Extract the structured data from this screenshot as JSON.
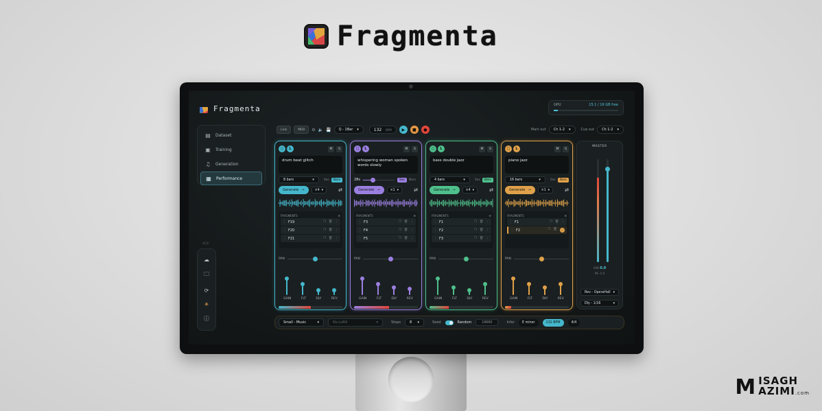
{
  "brand": {
    "name": "Fragmenta"
  },
  "signature": {
    "initial": "M",
    "line1": "ISAGH",
    "line2": "AZIMI",
    "suffix": ".com"
  },
  "app": {
    "name": "Fragmenta",
    "gpu": {
      "label": "GPU",
      "value": "15.1 / 16 GB free",
      "usage": 0.06
    },
    "nav": [
      {
        "label": "Dataset",
        "icon": "database-icon"
      },
      {
        "label": "Training",
        "icon": "training-icon"
      },
      {
        "label": "Generation",
        "icon": "music-note-icon"
      },
      {
        "label": "Performance",
        "icon": "performance-icon"
      }
    ],
    "tools_caption": "v1.0",
    "toolbar": {
      "link_label": "Link",
      "midi_label": "MIDI",
      "quantize": "Q - 1Bar",
      "bpm_value": "132",
      "bpm_unit": "BPM",
      "main_out_label": "Main out",
      "main_out_value": "Ch 1-2",
      "cue_out_label": "Cue out",
      "cue_out_value": "Ch 1-2"
    },
    "tracks": [
      {
        "prompt": "drum beat glitch",
        "length": "8 bars",
        "sec_label": "Sec",
        "bars_label": "Bars",
        "generate_label": "Generate",
        "multiplier": "×4",
        "fragments_title": "FRAGMENTS",
        "fragments": [
          "F19",
          "F20",
          "F21"
        ],
        "pan_label": "PAN",
        "fader_labels": [
          "GAIN",
          "FLT",
          "DLY",
          "REV"
        ],
        "fader_levels": [
          0.75,
          0.45,
          0.15,
          0.15
        ],
        "pan_value": 0.5,
        "meter_level": 0.5,
        "color": "#45b7cc"
      },
      {
        "prompt": "whispering woman spoken words slowly",
        "length": "28s",
        "length_slider": 0.3,
        "sec_label": "Sec",
        "bars_label": "Bars",
        "generate_label": "Generate",
        "multiplier": "×1",
        "fragments_title": "FRAGMENTS",
        "fragments": [
          "F3",
          "F4",
          "F5"
        ],
        "pan_label": "PAN",
        "fader_labels": [
          "GAIN",
          "FLT",
          "DLY",
          "REV"
        ],
        "fader_levels": [
          0.75,
          0.45,
          0.3,
          0.2
        ],
        "pan_value": 0.5,
        "meter_level": 0.55,
        "color": "#9b7fe0"
      },
      {
        "prompt": "bass double jazz",
        "length": "4 bars",
        "sec_label": "Sec",
        "bars_label": "Bars",
        "generate_label": "Generate",
        "multiplier": "×4",
        "fragments_title": "FRAGMENTS",
        "fragments": [
          "F1",
          "F2",
          "F3"
        ],
        "pan_label": "PAN",
        "fader_labels": [
          "GAIN",
          "FLT",
          "DLY",
          "REV"
        ],
        "fader_levels": [
          0.75,
          0.3,
          0.15,
          0.45
        ],
        "pan_value": 0.5,
        "meter_level": 0.3,
        "color": "#4fc08c"
      },
      {
        "prompt": "piano jazz",
        "length": "16 bars",
        "sec_label": "Sec",
        "bars_label": "Bars",
        "generate_label": "Generate",
        "multiplier": "×1",
        "fragments_title": "FRAGMENTS",
        "fragments": [
          "F1",
          "F2"
        ],
        "pan_label": "PAN",
        "fader_labels": [
          "GAIN",
          "FLT",
          "DLY",
          "REV"
        ],
        "fader_levels": [
          0.75,
          0.45,
          0.3,
          0.45
        ],
        "pan_value": 0.5,
        "meter_level": 0.1,
        "color": "#e0a14a"
      }
    ],
    "master": {
      "title": "MASTER",
      "db": "0dB",
      "db_value": "0.0",
      "peak_label": "PK",
      "peak_value": "-5.9",
      "reverb": "Rev - OperaHall",
      "delay": "Dly - 1/16",
      "level_left": 0.82,
      "level_right": 0.9
    },
    "bottom": {
      "model": "Small - Music",
      "lora_placeholder": "No LoRA",
      "steps_label": "Steps",
      "steps_value": "8",
      "seed_label": "Seed",
      "random_label": "Random",
      "seed_value": "19660",
      "infer_label": "Infer",
      "key": "E minor",
      "bpm": "132 BPM",
      "time_sig": "4/4"
    }
  },
  "colors": {
    "cyan": "#45b7cc",
    "purple": "#9b7fe0",
    "green": "#4fc08c",
    "orange": "#e0a14a",
    "red": "#e0463c"
  }
}
